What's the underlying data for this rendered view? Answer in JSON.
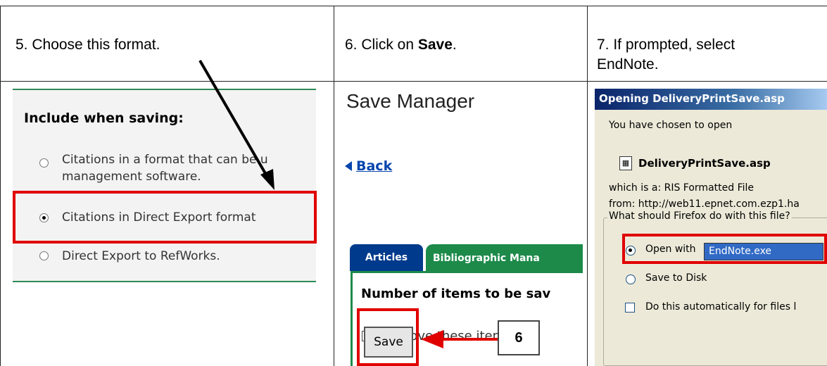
{
  "steps": {
    "step5": "5. Choose this format.",
    "step6_prefix": "6. Click on ",
    "step6_bold": "Save",
    "step6_suffix": ".",
    "step7_line1": "7. If prompted, select",
    "step7_line2": "EndNote."
  },
  "include_panel": {
    "heading": "Include when saving:",
    "options": [
      {
        "line1": "Citations in a format that can be u",
        "line2": "management software.",
        "selected": false
      },
      {
        "line1": "Citations in Direct Export format",
        "selected": true
      },
      {
        "line1": "Direct Export to RefWorks.",
        "selected": false
      }
    ]
  },
  "save_manager": {
    "title": "Save Manager",
    "back_link": "Back",
    "tabs": [
      "Articles",
      "Bibliographic Mana"
    ],
    "number_label": "Number of items to be sav",
    "remove_label": "Remove these items fror",
    "save_button": "Save",
    "callout_number": "6"
  },
  "dialog": {
    "title": "Opening DeliveryPrintSave.asp",
    "chosen_text": "You have chosen to open",
    "file_name": "DeliveryPrintSave.asp",
    "which_is": "which is a:  RIS Formatted File",
    "from": "from: http://web11.epnet.com.ezp1.ha",
    "group_label": "What should Firefox do with this file?",
    "open_with_label": "Open with",
    "open_with_app": "EndNote.exe",
    "save_to_disk": "Save to Disk",
    "auto_label": "Do this automatically for files l"
  },
  "colors": {
    "highlight_red": "#e00000",
    "green": "#1d8a4a",
    "blue_tab": "#003a8c",
    "link_blue": "#0645ad"
  }
}
